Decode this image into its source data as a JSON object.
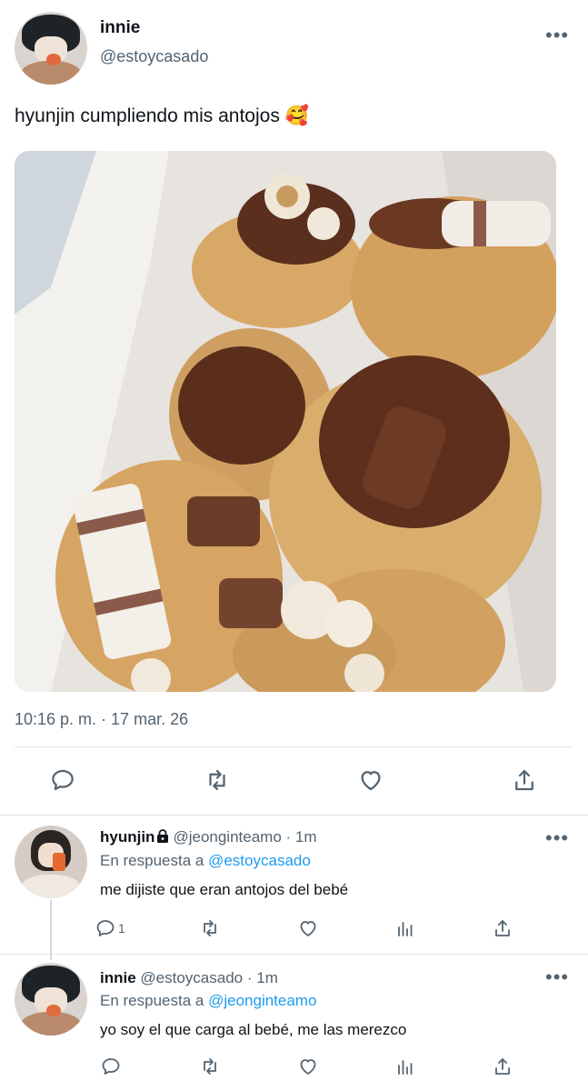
{
  "main_tweet": {
    "author_name": "innie",
    "author_handle": "@estoycasado",
    "text": "hyunjin cumpliendo mis antojos 🥰",
    "timestamp": "10:16 p. m. · 17 mar. 26",
    "more_label": "•••"
  },
  "replies": [
    {
      "author_name": "hyunjin",
      "author_handle": "@jeonginteamo",
      "time_ago": "1m",
      "reply_prefix": "En respuesta a",
      "reply_to": "@estoycasado",
      "text": "me dijiste que eran antojos del bebé",
      "reply_count": "1",
      "more_label": "•••"
    },
    {
      "author_name": "innie",
      "author_handle": "@estoycasado",
      "time_ago": "1m",
      "reply_prefix": "En respuesta a",
      "reply_to": "@jeonginteamo",
      "text": "yo soy el que carga al bebé, me las merezco",
      "more_label": "•••"
    }
  ],
  "icons": [
    "reply-icon",
    "retweet-icon",
    "like-icon",
    "share-icon",
    "analytics-icon",
    "lock-icon",
    "more-icon"
  ],
  "colors": {
    "text": "#0f1419",
    "secondary": "#536471",
    "link": "#1d9bf0",
    "divider": "#e1e6ea"
  }
}
